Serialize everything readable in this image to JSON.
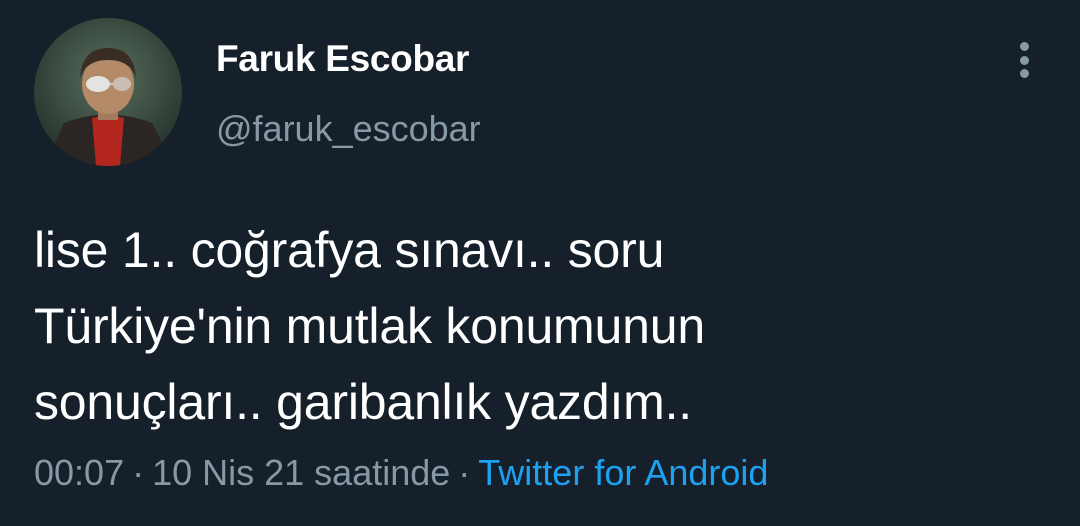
{
  "user": {
    "display_name": "Faruk Escobar",
    "handle": "@faruk_escobar",
    "avatar_icon": "profile-photo"
  },
  "menu": {
    "icon": "more-vertical-icon"
  },
  "tweet": {
    "lines": [
      "lise 1.. coğrafya sınavı.. soru",
      "Türkiye'nin mutlak konumunun",
      "sonuçları.. garibanlık yazdım.."
    ]
  },
  "meta": {
    "time": "00:07",
    "separator": "·",
    "date": "10 Nis 21 saatinde",
    "source": "Twitter for Android"
  },
  "colors": {
    "background": "#15202b",
    "primary_text": "#ffffff",
    "secondary_text": "#8899a6",
    "link": "#1da1f2"
  }
}
